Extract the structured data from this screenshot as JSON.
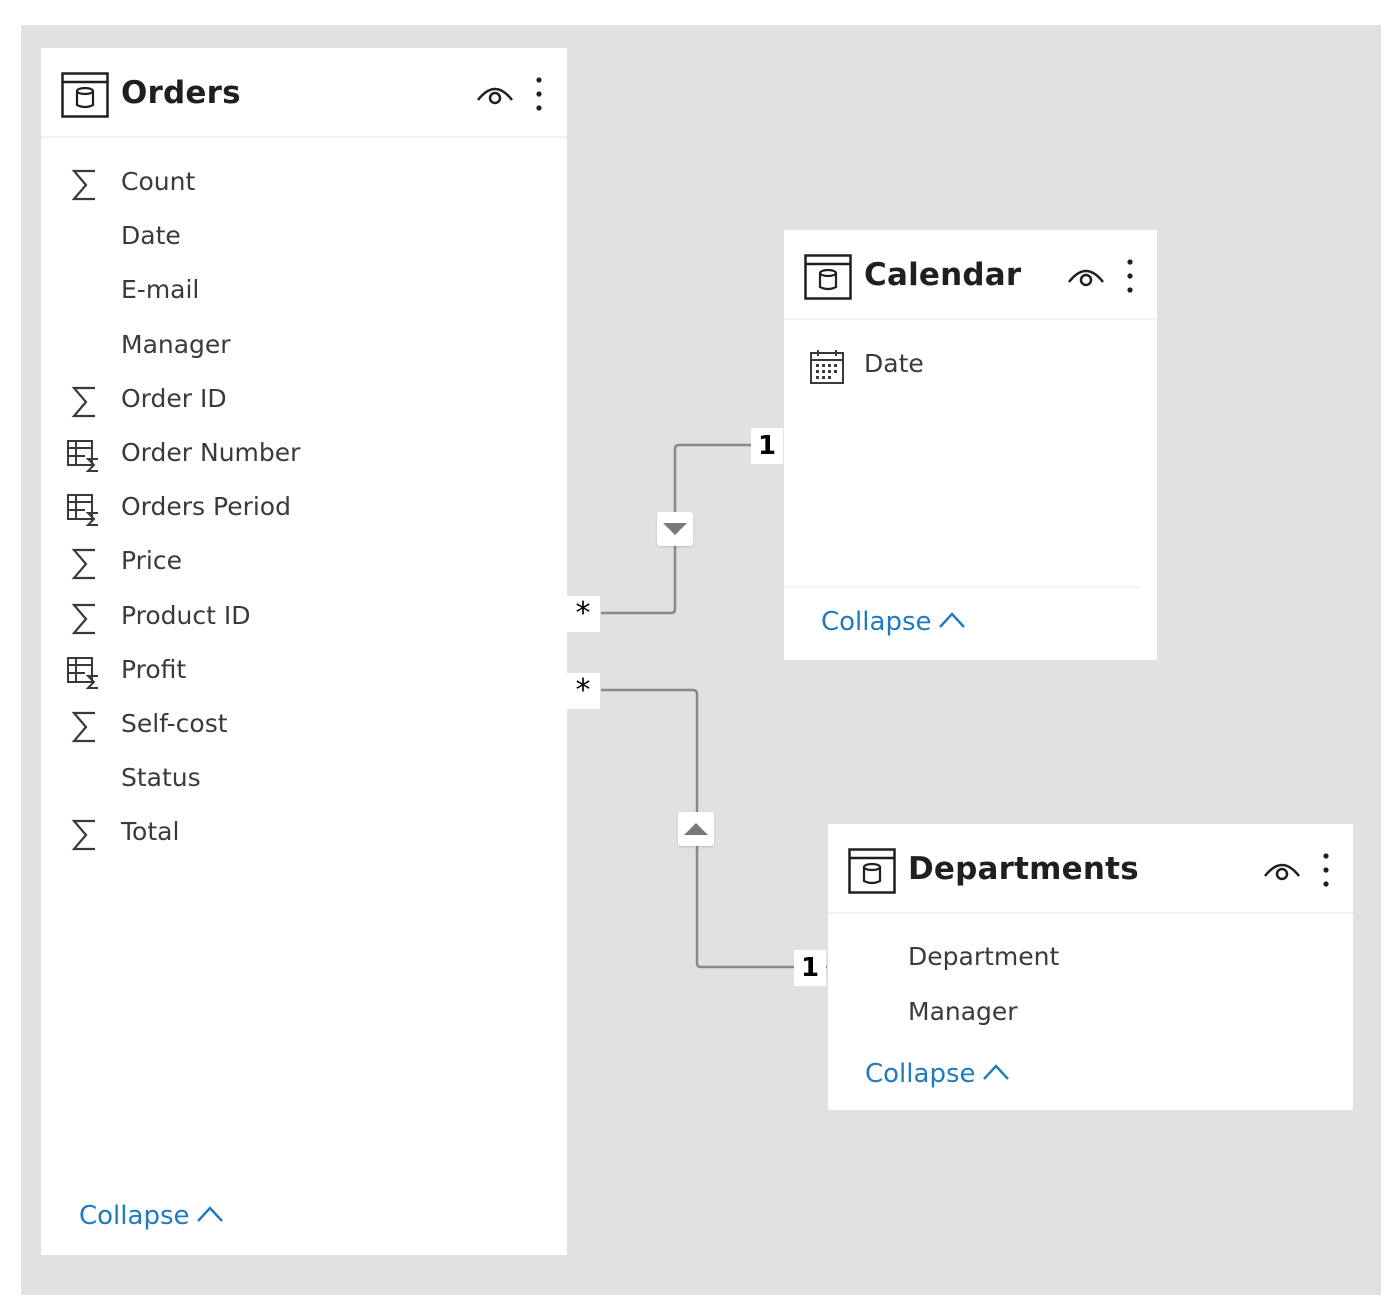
{
  "tables": {
    "orders": {
      "title": "Orders",
      "fields": [
        {
          "label": "Count",
          "icon": "sigma-icon"
        },
        {
          "label": "Date",
          "icon": ""
        },
        {
          "label": "E-mail",
          "icon": ""
        },
        {
          "label": "Manager",
          "icon": ""
        },
        {
          "label": "Order ID",
          "icon": "sigma-icon"
        },
        {
          "label": "Order Number",
          "icon": "measure-table-icon"
        },
        {
          "label": "Orders Period",
          "icon": "measure-table-icon"
        },
        {
          "label": "Price",
          "icon": "sigma-icon"
        },
        {
          "label": "Product ID",
          "icon": "sigma-icon"
        },
        {
          "label": "Profit",
          "icon": "measure-table-icon"
        },
        {
          "label": "Self-cost",
          "icon": "sigma-icon"
        },
        {
          "label": "Status",
          "icon": ""
        },
        {
          "label": "Total",
          "icon": "sigma-icon"
        }
      ],
      "collapse_label": "Collapse"
    },
    "calendar": {
      "title": "Calendar",
      "fields": [
        {
          "label": "Date",
          "icon": "calendar-icon"
        }
      ],
      "collapse_label": "Collapse"
    },
    "departments": {
      "title": "Departments",
      "fields": [
        {
          "label": "Department",
          "icon": ""
        },
        {
          "label": "Manager",
          "icon": ""
        }
      ],
      "collapse_label": "Collapse"
    }
  },
  "relationships": {
    "orders_calendar": {
      "many_label": "*",
      "one_label": "1",
      "direction": "down"
    },
    "orders_departments": {
      "many_label": "*",
      "one_label": "1",
      "direction": "up"
    }
  },
  "colors": {
    "canvas": "#e2e1e0",
    "link": "#1e7bc2",
    "line": "#8a8886"
  }
}
